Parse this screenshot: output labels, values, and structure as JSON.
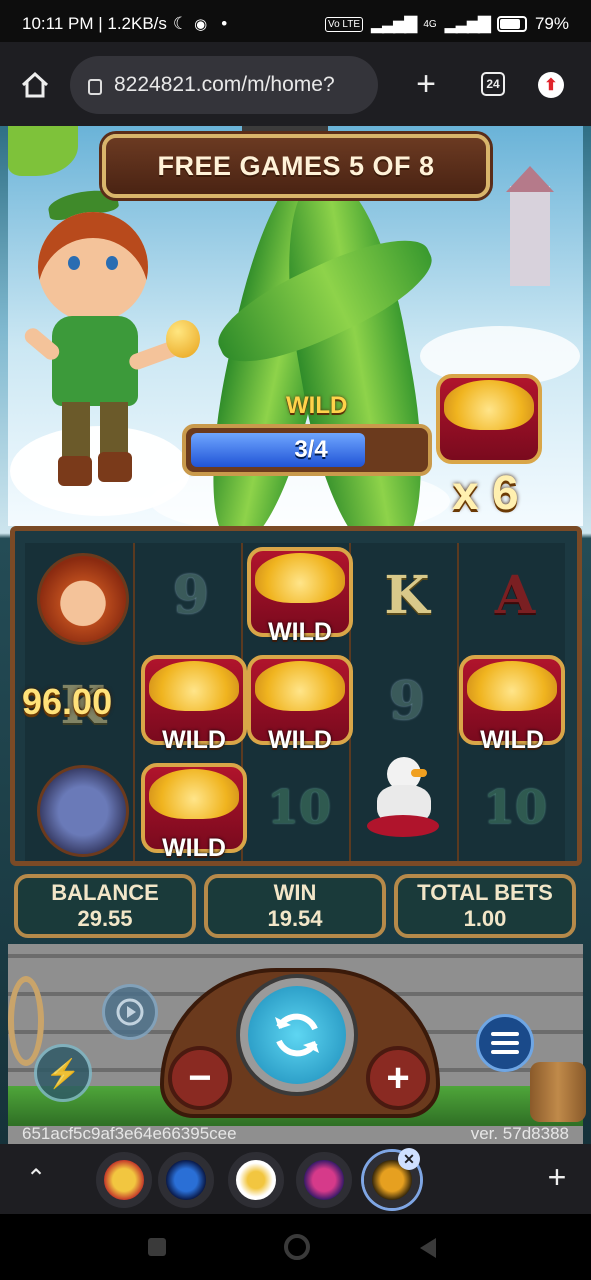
{
  "status_bar": {
    "time_speed": "10:11 PM | 1.2KB/s",
    "battery": "79%",
    "network": "4G"
  },
  "browser": {
    "url": "8224821.com/m/home?",
    "tab_count": "24"
  },
  "game": {
    "banner": "FREE GAMES 5 OF 8",
    "wild_label": "WILD",
    "wild_meter_text": "3/4",
    "wild_meter_progress": 0.75,
    "multiplier": "x 6",
    "win_amount": "96.00",
    "wild_symbol_text": "WILD",
    "symbols": {
      "nine": "9",
      "k": "K",
      "a": "A",
      "ten": "10"
    },
    "stats": {
      "balance_label": "BALANCE",
      "balance_value": "29.55",
      "win_label": "WIN",
      "win_value": "19.54",
      "total_bets_label": "TOTAL BETS",
      "total_bets_value": "1.00"
    },
    "session_id": "651acf5c9af3e64e66395cee",
    "version": "ver. 57d8388"
  },
  "colors": {
    "banner_text": "#fff2d8",
    "gold": "#ffd34a",
    "meter_blue": "#2054d6"
  }
}
